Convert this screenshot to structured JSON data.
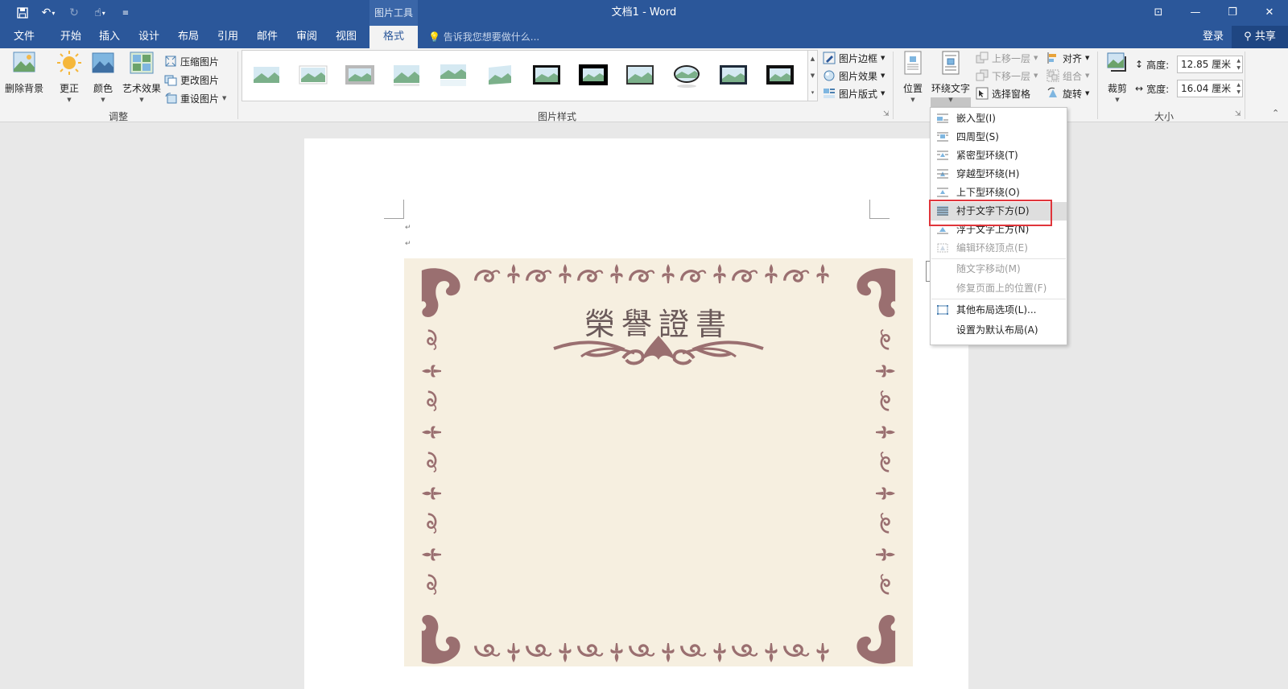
{
  "titlebar": {
    "context_tool": "图片工具",
    "document_title": "文档1 - Word",
    "tell_me_placeholder": "告诉我您想要做什么...",
    "login": "登录",
    "share": "共享"
  },
  "tabs": [
    {
      "label": "文件"
    },
    {
      "label": "开始"
    },
    {
      "label": "插入"
    },
    {
      "label": "设计"
    },
    {
      "label": "布局"
    },
    {
      "label": "引用"
    },
    {
      "label": "邮件"
    },
    {
      "label": "审阅"
    },
    {
      "label": "视图"
    },
    {
      "label": "格式"
    }
  ],
  "ribbon": {
    "adjust": {
      "remove_background": "删除背景",
      "corrections": "更正",
      "color": "颜色",
      "artistic_effects": "艺术效果",
      "compress": "压缩图片",
      "change": "更改图片",
      "reset": "重设图片",
      "group_label": "调整"
    },
    "styles": {
      "border": "图片边框",
      "effects": "图片效果",
      "layout": "图片版式",
      "group_label": "图片样式"
    },
    "arrange": {
      "position": "位置",
      "wrap_text": "环绕文字",
      "bring_forward": "上移一层",
      "send_backward": "下移一层",
      "selection_pane": "选择窗格",
      "align": "对齐",
      "group": "组合",
      "rotate": "旋转"
    },
    "size": {
      "crop": "裁剪",
      "height_label": "高度:",
      "height_value": "12.85 厘米",
      "width_label": "宽度:",
      "width_value": "16.04 厘米",
      "group_label": "大小"
    }
  },
  "wrap_menu": {
    "items": [
      {
        "label": "嵌入型(I)"
      },
      {
        "label": "四周型(S)"
      },
      {
        "label": "紧密型环绕(T)"
      },
      {
        "label": "穿越型环绕(H)"
      },
      {
        "label": "上下型环绕(O)"
      },
      {
        "label": "衬于文字下方(D)"
      },
      {
        "label": "浮于文字上方(N)"
      },
      {
        "label": "编辑环绕顶点(E)"
      },
      {
        "label": "随文字移动(M)"
      },
      {
        "label": "修复页面上的位置(F)"
      },
      {
        "label": "其他布局选项(L)..."
      },
      {
        "label": "设置为默认布局(A)"
      }
    ]
  },
  "certificate": {
    "title": "榮譽證書"
  },
  "colors": {
    "accent": "#2b579a",
    "highlight_box": "#e0353b",
    "cert_border": "#9a6f70",
    "cert_bg": "#f6efe0"
  }
}
